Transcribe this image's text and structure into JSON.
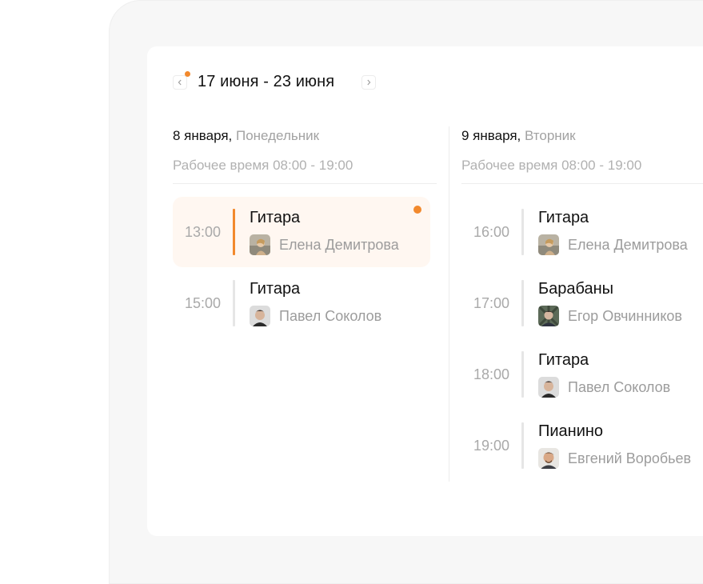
{
  "header": {
    "range": "17 июня - 23 июня",
    "prev_icon": "chevron-left-icon",
    "next_icon": "chevron-right-icon"
  },
  "days": [
    {
      "date": "8 января,",
      "weekday": "Понедельник",
      "work_hours": "Рабочее время 08:00 - 19:00",
      "lessons": [
        {
          "time": "13:00",
          "subject": "Гитара",
          "teacher": "Елена Демитрова",
          "active": true
        },
        {
          "time": "15:00",
          "subject": "Гитара",
          "teacher": "Павел Соколов",
          "active": false
        }
      ]
    },
    {
      "date": "9 января,",
      "weekday": "Вторник",
      "work_hours": "Рабочее время 08:00 - 19:00",
      "lessons": [
        {
          "time": "16:00",
          "subject": "Гитара",
          "teacher": "Елена Демитрова",
          "active": false
        },
        {
          "time": "17:00",
          "subject": "Барабаны",
          "teacher": "Егор Овчинников",
          "active": false
        },
        {
          "time": "18:00",
          "subject": "Гитара",
          "teacher": "Павел Соколов",
          "active": false
        },
        {
          "time": "19:00",
          "subject": "Пианино",
          "teacher": "Евгений Воробьев",
          "active": false
        }
      ]
    }
  ],
  "colors": {
    "accent": "#f2892d",
    "active_bg": "#fff7f1",
    "muted_text": "#a9a9a9"
  }
}
